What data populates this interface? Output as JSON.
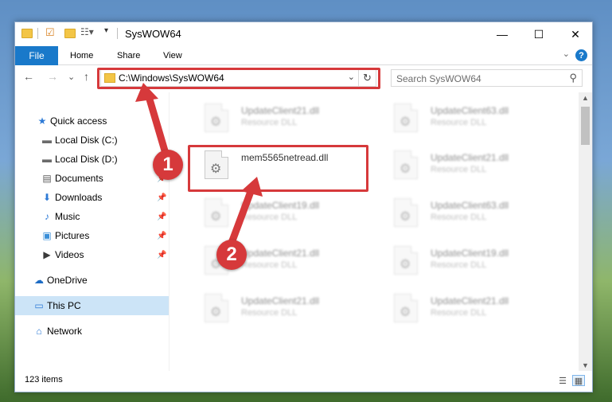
{
  "window": {
    "title": "SysWOW64",
    "controls": {
      "minimize": "—",
      "maximize": "☐",
      "close": "✕"
    }
  },
  "ribbon": {
    "file_label": "File",
    "tabs": [
      "Home",
      "Share",
      "View"
    ],
    "help": "?"
  },
  "nav": {
    "back": "←",
    "forward": "→",
    "recent": "⌄",
    "up": "↑",
    "address": "C:\\Windows\\SysWOW64",
    "refresh": "↻",
    "search_placeholder": "Search SysWOW64"
  },
  "sidebar": {
    "items": [
      {
        "label": "Quick access",
        "icon": "star-icon",
        "pinned": false
      },
      {
        "label": "Local Disk (C:)",
        "icon": "drive-icon",
        "pinned": false
      },
      {
        "label": "Local Disk (D:)",
        "icon": "drive-icon",
        "pinned": false
      },
      {
        "label": "Documents",
        "icon": "documents-icon",
        "pinned": true
      },
      {
        "label": "Downloads",
        "icon": "downloads-icon",
        "pinned": true
      },
      {
        "label": "Music",
        "icon": "music-icon",
        "pinned": true
      },
      {
        "label": "Pictures",
        "icon": "pictures-icon",
        "pinned": true
      },
      {
        "label": "Videos",
        "icon": "videos-icon",
        "pinned": true
      },
      {
        "label": "OneDrive",
        "icon": "cloud-icon",
        "pinned": false
      },
      {
        "label": "This PC",
        "icon": "computer-icon",
        "pinned": false,
        "selected": true
      },
      {
        "label": "Network",
        "icon": "network-icon",
        "pinned": false
      }
    ]
  },
  "files": {
    "left_column": [
      {
        "name": "UpdateClient21.dll",
        "type": "Resource DLL"
      },
      {
        "name": "mem5565netread.dll",
        "type": ""
      },
      {
        "name": "UpdateClient19.dll",
        "type": "Resource DLL"
      },
      {
        "name": "UpdateClient21.dll",
        "type": "Resource DLL"
      },
      {
        "name": "UpdateClient21.dll",
        "type": "Resource DLL"
      }
    ],
    "right_column": [
      {
        "name": "UpdateClient63.dll",
        "type": "Resource DLL"
      },
      {
        "name": "UpdateClient21.dll",
        "type": "Resource DLL"
      },
      {
        "name": "UpdateClient63.dll",
        "type": "Resource DLL"
      },
      {
        "name": "UpdateClient19.dll",
        "type": "Resource DLL"
      },
      {
        "name": "UpdateClient21.dll",
        "type": "Resource DLL"
      }
    ]
  },
  "status": {
    "items": "123 items"
  },
  "annotations": {
    "badge_1": "1",
    "badge_2": "2",
    "color": "#d6393b"
  }
}
